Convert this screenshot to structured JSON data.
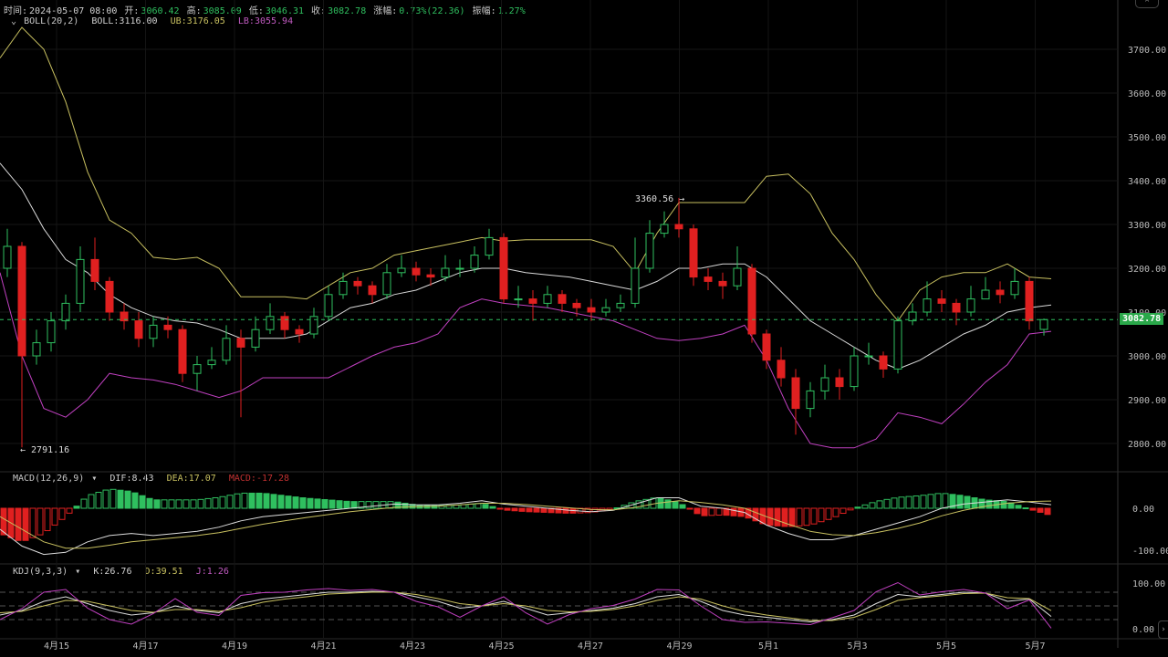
{
  "info": {
    "time_label": "时间:",
    "time": "2024-05-07 08:00",
    "open_label": "开:",
    "open": "3060.42",
    "high_label": "高:",
    "high": "3085.09",
    "low_label": "低:",
    "low": "3046.31",
    "close_label": "收:",
    "close": "3082.78",
    "change_label": "涨幅:",
    "change": "0.73%(22.36)",
    "amp_label": "振幅:",
    "amp": "1.27%"
  },
  "boll": {
    "name": "BOLL(20,2)",
    "mid": "BOLL:3116.00",
    "ub": "UB:3176.05",
    "lb": "LB:3055.94"
  },
  "macd": {
    "name": "MACD(12,26,9)",
    "dif": "DIF:8.43",
    "dea": "DEA:17.07",
    "macd": "MACD:-17.28"
  },
  "kdj": {
    "name": "KDJ(9,3,3)",
    "k": "K:26.76",
    "d": "D:39.51",
    "j": "J:1.26"
  },
  "current_price": "3082.78",
  "colors": {
    "up": "#2fbf5f",
    "down": "#e02020",
    "upper": "#c8c060",
    "mid": "#d8d8d8",
    "lower": "#c040c0"
  },
  "chart_data": {
    "type": "candlestick",
    "x_tick_labels": [
      "4月15",
      "4月17",
      "4月19",
      "4月21",
      "4月23",
      "4月25",
      "4月27",
      "4月29",
      "5月1",
      "5月3",
      "5月5",
      "5月7"
    ],
    "price_ticks": [
      "3700.00",
      "3600.00",
      "3500.00",
      "3400.00",
      "3300.00",
      "3200.00",
      "3100.00",
      "3000.00",
      "2900.00",
      "2800.00"
    ],
    "price_range": [
      2735,
      3800
    ],
    "annotations": {
      "max": "3360.56",
      "min": "2791.16"
    },
    "candles_ohlc": [
      [
        3200,
        3290,
        3180,
        3250
      ],
      [
        3250,
        3260,
        2791.16,
        3000
      ],
      [
        3000,
        3060,
        2980,
        3030
      ],
      [
        3030,
        3100,
        3010,
        3080
      ],
      [
        3080,
        3140,
        3060,
        3120
      ],
      [
        3120,
        3250,
        3100,
        3220
      ],
      [
        3220,
        3270,
        3150,
        3170
      ],
      [
        3170,
        3180,
        3080,
        3100
      ],
      [
        3100,
        3120,
        3060,
        3080
      ],
      [
        3080,
        3100,
        3020,
        3040
      ],
      [
        3040,
        3090,
        3020,
        3070
      ],
      [
        3070,
        3090,
        3040,
        3060
      ],
      [
        3060,
        3070,
        2940,
        2960
      ],
      [
        2960,
        3000,
        2920,
        2980
      ],
      [
        2980,
        3020,
        2970,
        2990
      ],
      [
        2990,
        3070,
        2980,
        3040
      ],
      [
        3040,
        3060,
        2860,
        3020
      ],
      [
        3020,
        3090,
        3010,
        3060
      ],
      [
        3060,
        3120,
        3050,
        3090
      ],
      [
        3090,
        3100,
        3040,
        3060
      ],
      [
        3060,
        3070,
        3030,
        3050
      ],
      [
        3050,
        3110,
        3040,
        3090
      ],
      [
        3090,
        3160,
        3080,
        3140
      ],
      [
        3140,
        3190,
        3130,
        3170
      ],
      [
        3170,
        3180,
        3140,
        3160
      ],
      [
        3160,
        3170,
        3120,
        3140
      ],
      [
        3140,
        3210,
        3130,
        3190
      ],
      [
        3190,
        3230,
        3180,
        3200
      ],
      [
        3200,
        3215,
        3170,
        3185
      ],
      [
        3185,
        3200,
        3160,
        3180
      ],
      [
        3180,
        3230,
        3170,
        3200
      ],
      [
        3200,
        3220,
        3180,
        3200
      ],
      [
        3200,
        3250,
        3190,
        3230
      ],
      [
        3230,
        3290,
        3220,
        3270
      ],
      [
        3270,
        3280,
        3120,
        3130
      ],
      [
        3130,
        3160,
        3110,
        3130
      ],
      [
        3130,
        3150,
        3080,
        3120
      ],
      [
        3120,
        3160,
        3110,
        3140
      ],
      [
        3140,
        3150,
        3100,
        3120
      ],
      [
        3120,
        3130,
        3090,
        3110
      ],
      [
        3110,
        3130,
        3080,
        3100
      ],
      [
        3100,
        3130,
        3090,
        3110
      ],
      [
        3110,
        3140,
        3100,
        3120
      ],
      [
        3120,
        3270,
        3110,
        3200
      ],
      [
        3200,
        3310,
        3190,
        3280
      ],
      [
        3280,
        3330,
        3270,
        3300
      ],
      [
        3300,
        3360.56,
        3270,
        3290
      ],
      [
        3290,
        3300,
        3160,
        3180
      ],
      [
        3180,
        3200,
        3150,
        3170
      ],
      [
        3170,
        3190,
        3130,
        3160
      ],
      [
        3160,
        3250,
        3150,
        3200
      ],
      [
        3200,
        3210,
        3030,
        3050
      ],
      [
        3050,
        3060,
        2970,
        2990
      ],
      [
        2990,
        3020,
        2930,
        2950
      ],
      [
        2950,
        2970,
        2820,
        2880
      ],
      [
        2880,
        2940,
        2860,
        2920
      ],
      [
        2920,
        2980,
        2900,
        2950
      ],
      [
        2950,
        2970,
        2900,
        2930
      ],
      [
        2930,
        3020,
        2920,
        3000
      ],
      [
        3000,
        3030,
        2980,
        3000
      ],
      [
        3000,
        3010,
        2950,
        2970
      ],
      [
        2970,
        3090,
        2960,
        3080
      ],
      [
        3080,
        3120,
        3070,
        3100
      ],
      [
        3100,
        3170,
        3090,
        3130
      ],
      [
        3130,
        3150,
        3100,
        3120
      ],
      [
        3120,
        3130,
        3070,
        3100
      ],
      [
        3100,
        3160,
        3090,
        3130
      ],
      [
        3130,
        3180,
        3130,
        3150
      ],
      [
        3150,
        3170,
        3120,
        3140
      ],
      [
        3140,
        3200,
        3130,
        3170
      ],
      [
        3170,
        3180,
        3060,
        3080
      ],
      [
        3060.42,
        3085.09,
        3046.31,
        3082.78
      ]
    ],
    "boll_upper": [
      3680,
      3750,
      3700,
      3580,
      3420,
      3310,
      3280,
      3225,
      3220,
      3225,
      3200,
      3135,
      3135,
      3135,
      3130,
      3160,
      3190,
      3200,
      3230,
      3240,
      3250,
      3260,
      3270,
      3262,
      3265,
      3265,
      3265,
      3265,
      3250,
      3190,
      3280,
      3350,
      3350,
      3350,
      3350,
      3410,
      3415,
      3370,
      3280,
      3220,
      3140,
      3080,
      3150,
      3180,
      3190,
      3190,
      3210,
      3180,
      3176.05
    ],
    "boll_mid": [
      3440,
      3380,
      3290,
      3220,
      3190,
      3140,
      3110,
      3090,
      3080,
      3075,
      3060,
      3040,
      3040,
      3040,
      3050,
      3080,
      3110,
      3120,
      3140,
      3150,
      3170,
      3190,
      3200,
      3200,
      3190,
      3185,
      3180,
      3170,
      3160,
      3150,
      3170,
      3200,
      3200,
      3210,
      3210,
      3180,
      3130,
      3080,
      3050,
      3020,
      2990,
      2970,
      2990,
      3020,
      3050,
      3070,
      3100,
      3110,
      3116
    ],
    "boll_lower": [
      3190,
      3000,
      2880,
      2860,
      2900,
      2960,
      2950,
      2945,
      2935,
      2920,
      2905,
      2920,
      2950,
      2950,
      2950,
      2950,
      2975,
      3000,
      3020,
      3030,
      3050,
      3110,
      3130,
      3120,
      3115,
      3110,
      3100,
      3090,
      3080,
      3060,
      3040,
      3035,
      3040,
      3050,
      3070,
      2990,
      2880,
      2800,
      2790,
      2790,
      2810,
      2870,
      2860,
      2845,
      2890,
      2940,
      2980,
      3050,
      3055.94
    ],
    "macd_ticks": [
      "0.00",
      "-100.00"
    ],
    "dif": [
      -50,
      -90,
      -110,
      -105,
      -80,
      -65,
      -60,
      -65,
      -60,
      -55,
      -45,
      -30,
      -20,
      -15,
      -10,
      -5,
      0,
      5,
      10,
      8,
      8,
      12,
      18,
      10,
      5,
      0,
      -5,
      -8,
      -5,
      10,
      25,
      25,
      5,
      0,
      -10,
      -40,
      -60,
      -75,
      -75,
      -65,
      -50,
      -35,
      -20,
      0,
      10,
      15,
      20,
      15,
      8.43
    ],
    "dea": [
      -20,
      -50,
      -80,
      -95,
      -95,
      -88,
      -80,
      -75,
      -70,
      -65,
      -58,
      -48,
      -38,
      -30,
      -22,
      -15,
      -8,
      -3,
      2,
      4,
      5,
      8,
      12,
      12,
      9,
      5,
      1,
      -3,
      -4,
      2,
      12,
      18,
      14,
      8,
      0,
      -20,
      -38,
      -55,
      -63,
      -65,
      -58,
      -48,
      -35,
      -18,
      -5,
      5,
      12,
      16,
      17.07
    ],
    "kdj_ticks": [
      "100.00",
      "0.00"
    ],
    "k": [
      30,
      40,
      60,
      70,
      55,
      40,
      30,
      35,
      50,
      40,
      35,
      55,
      65,
      70,
      75,
      80,
      80,
      82,
      80,
      70,
      60,
      45,
      50,
      60,
      45,
      30,
      35,
      40,
      45,
      55,
      70,
      75,
      60,
      40,
      30,
      25,
      20,
      15,
      20,
      30,
      55,
      75,
      70,
      75,
      80,
      78,
      60,
      65,
      26.76
    ],
    "d": [
      35,
      38,
      50,
      62,
      60,
      50,
      40,
      36,
      42,
      42,
      38,
      46,
      58,
      65,
      70,
      76,
      78,
      80,
      80,
      75,
      66,
      55,
      50,
      55,
      50,
      40,
      37,
      38,
      42,
      50,
      62,
      70,
      65,
      50,
      38,
      30,
      24,
      18,
      18,
      25,
      42,
      62,
      68,
      72,
      77,
      78,
      68,
      66,
      39.51
    ]
  }
}
